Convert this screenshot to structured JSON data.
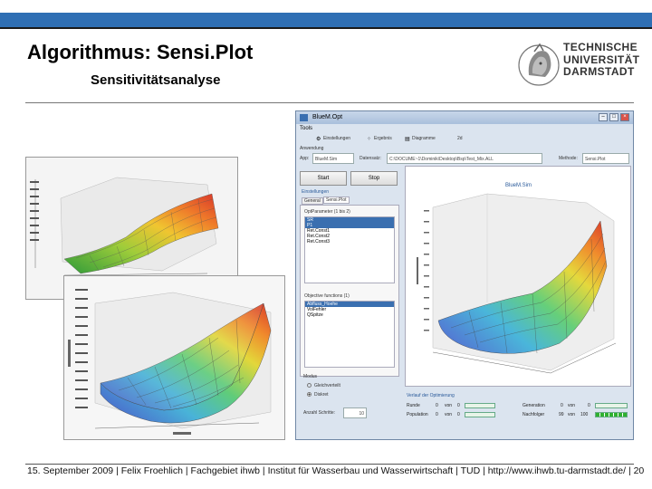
{
  "slide": {
    "title": "Algorithmus: Sensi.Plot",
    "subtitle": "Sensitivitätsanalyse",
    "footer": "15. September 2009 | Felix Froehlich | Fachgebiet ihwb | Institut für Wasserbau und Wasserwirtschaft | TUD | http://www.ihwb.tu-darmstadt.de/ | 20",
    "brand_color": "#2f6fb4"
  },
  "logo": {
    "text": "TECHNISCHE\nUNIVERSITÄT\nDARMSTADT",
    "icon": "athena-head-icon"
  },
  "app": {
    "window_title": "BlueM.Opt",
    "menu": "Tools",
    "toolbar": {
      "settings": "Einstellungen",
      "scatter": "Ergebnis",
      "diagrams": "Diagramme",
      "extra": "2d"
    },
    "section_label": "Anwendung",
    "app_label": "App:",
    "app_value": "BlueM.Sim",
    "dataset_label": "Datensatz:",
    "dataset_value": "C:\\DOCUME~1\\Dominik\\Desktop\\Bsp\\Test_Mix.ALL",
    "method_label": "Methode:",
    "method_value": "Sensi.Plot",
    "start_button": "Start",
    "stop_button": "Stop",
    "settings_label": "Einstellungen",
    "tabs": [
      "General",
      "Sensi.Plot"
    ],
    "opt_params_label": "OptParameter (1 bis 2)",
    "opt_params": [
      {
        "label": "SR",
        "selected": true
      },
      {
        "label": "P1",
        "selected": true
      },
      {
        "label": "Ret.Const1",
        "selected": false
      },
      {
        "label": "Ret.Const2",
        "selected": false
      },
      {
        "label": "Ret.Const3",
        "selected": false
      }
    ],
    "objectives_label": "Objective functions (1)",
    "objectives": [
      {
        "label": "Abfluss_Hoehe",
        "selected": true
      },
      {
        "label": "VolFehler",
        "selected": false
      },
      {
        "label": "QSpitze",
        "selected": false
      }
    ],
    "mode_label": "Modus",
    "modes": [
      {
        "label": "Gleichverteilt",
        "checked": false
      },
      {
        "label": "Diskret",
        "checked": true
      }
    ],
    "steps_label": "Anzahl Schritte:",
    "steps_value": "10",
    "chart_title": "BlueM.Sim",
    "progress_label": "Verlauf der Optimierung",
    "progress_rows": [
      {
        "label": "Runde",
        "val": "0",
        "of": "von",
        "max": "0"
      },
      {
        "label": "Population",
        "val": "0",
        "of": "von",
        "max": "0"
      }
    ],
    "progress_rows_right": [
      {
        "label": "Generation",
        "val": "0",
        "of": "von",
        "max": "0"
      },
      {
        "label": "Nachfolger",
        "val": "99",
        "of": "von",
        "max": "100"
      }
    ]
  }
}
